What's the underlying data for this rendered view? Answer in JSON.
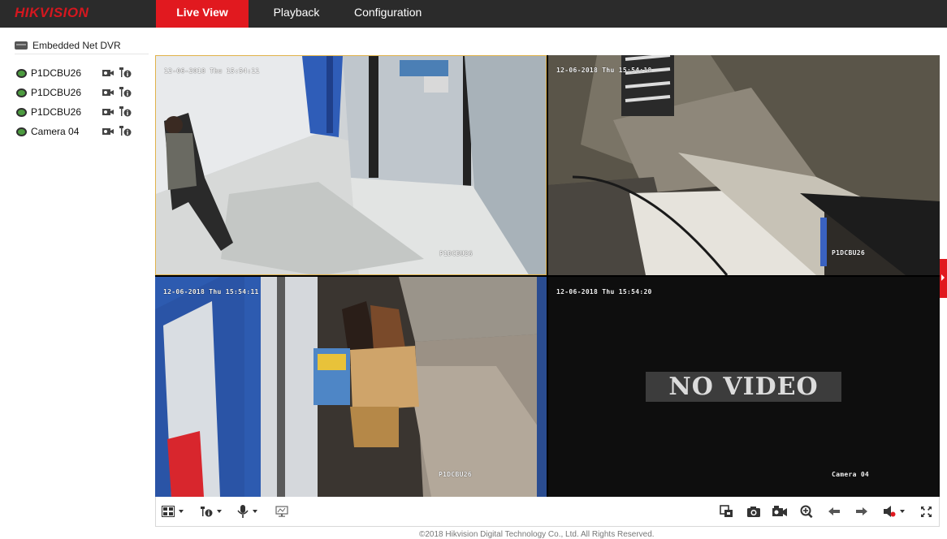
{
  "brand": {
    "logo_text": "HIKVISION",
    "accent_color": "#e1191f"
  },
  "nav": {
    "tabs": [
      {
        "label": "Live View",
        "active": true
      },
      {
        "label": "Playback",
        "active": false
      },
      {
        "label": "Configuration",
        "active": false
      }
    ]
  },
  "sidebar": {
    "device_label": "Embedded Net DVR",
    "device_icon": "dvr-icon",
    "cameras": [
      {
        "label": "P1DCBU26",
        "status_color": "#4c9b3f"
      },
      {
        "label": "P1DCBU26",
        "status_color": "#4c9b3f"
      },
      {
        "label": "P1DCBU26",
        "status_color": "#4c9b3f"
      },
      {
        "label": "Camera 04",
        "status_color": "#4c9b3f"
      }
    ]
  },
  "grid": {
    "tiles": [
      {
        "timestamp": "12-06-2018 Thu 15:54:11",
        "camera_name": "P1DCBU26",
        "selected": true
      },
      {
        "timestamp": "12-06-2018 Thu 15:54:18",
        "camera_name": "P1DCBU26",
        "selected": false
      },
      {
        "timestamp": "12-06-2018 Thu 15:54:11",
        "camera_name": "P1DCBU26",
        "selected": false
      },
      {
        "timestamp": "12-06-2018 Thu 15:54:20",
        "camera_name": "Camera 04",
        "selected": false,
        "no_video_text": "NO VIDEO"
      }
    ]
  },
  "toolbar": {
    "left_icons": [
      "window-layout-icon",
      "ptz-control-icon",
      "microphone-icon",
      "image-adjust-icon"
    ],
    "right_icons": [
      "stop-all-icon",
      "capture-icon",
      "record-icon",
      "digital-zoom-icon",
      "previous-page-icon",
      "next-page-icon",
      "volume-icon",
      "fullscreen-icon"
    ]
  },
  "footer": {
    "text": "©2018 Hikvision Digital Technology Co., Ltd. All Rights Reserved."
  }
}
